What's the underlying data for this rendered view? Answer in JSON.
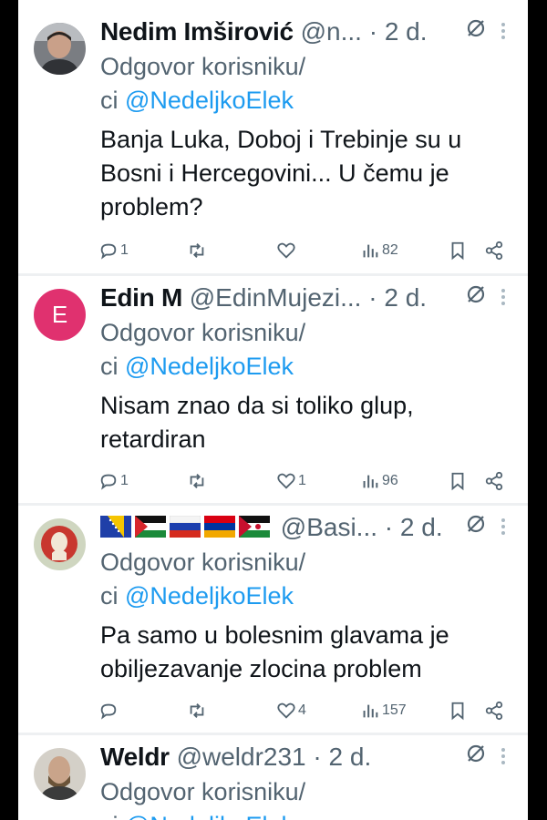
{
  "common": {
    "reply_label": "Odgovor korisniku/",
    "reply_label_cont": "ci ",
    "reply_mention": "@NedeljkoElek",
    "sep": "·"
  },
  "tweets": [
    {
      "name": "Nedim Imširović",
      "handle": "@n...",
      "time": "2 d.",
      "body": [
        "Banja Luka, Doboj i Trebinje su u",
        "Bosni i Hercegovini... U čemu je",
        "problem?"
      ],
      "replies": "1",
      "likes": "",
      "views": "82"
    },
    {
      "name": "Edin M",
      "avatar_letter": "E",
      "handle": "@EdinMujezi...",
      "time": "2 d.",
      "body": [
        "Nisam znao da si toliko glup,",
        "retardiran"
      ],
      "replies": "1",
      "likes": "1",
      "views": "96"
    },
    {
      "name": "",
      "handle": "@Basi...",
      "time": "2 d.",
      "body": [
        "Pa samo u bolesnim glavama je",
        "obiljezavanje zlocina problem"
      ],
      "replies": "",
      "likes": "4",
      "views": "157"
    },
    {
      "name": "Weldr",
      "handle": "@weldr231",
      "time": "2 d.",
      "body": [],
      "replies": "",
      "likes": "",
      "views": ""
    }
  ],
  "colors": {
    "accent": "#1d9bf0",
    "muted": "#536471",
    "text": "#0f1419",
    "avatar_e": "#e0316f"
  }
}
